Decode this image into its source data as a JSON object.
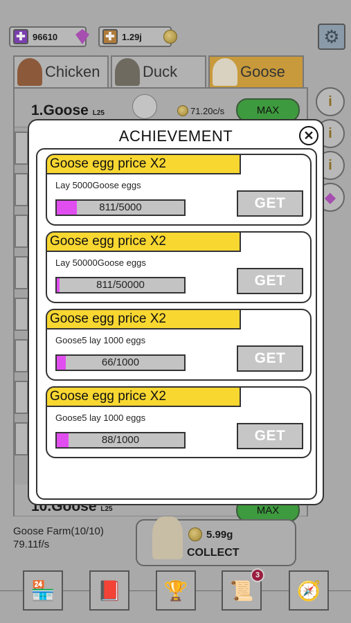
{
  "resources": {
    "gems": "96610",
    "gold": "1.29j"
  },
  "tabs": [
    {
      "label": "Chicken"
    },
    {
      "label": "Duck"
    },
    {
      "label": "Goose"
    }
  ],
  "list": {
    "first_row": {
      "name": "1.Goose",
      "level": "L25",
      "rate": "71.20c/s",
      "button": "MAX"
    },
    "last_row": {
      "name": "10.Goose",
      "level": "L25",
      "button": "MAX"
    }
  },
  "side_buttons": [
    "i",
    "i",
    "i"
  ],
  "farm": {
    "name": "Goose Farm(10/10)",
    "rate": "79.11f/s"
  },
  "collect": {
    "amount": "5.99g",
    "label": "COLLECT"
  },
  "nav": {
    "badge_count": "3"
  },
  "modal": {
    "title": "ACHIEVEMENT",
    "close": "✕",
    "achievements": [
      {
        "title": "Goose egg price X2",
        "desc": "Lay 5000Goose eggs",
        "progress_text": "811/5000",
        "progress": 0.16,
        "button": "GET"
      },
      {
        "title": "Goose egg price X2",
        "desc": "Lay 50000Goose eggs",
        "progress_text": "811/50000",
        "progress": 0.02,
        "button": "GET"
      },
      {
        "title": "Goose egg price X2",
        "desc": "Goose5 lay 1000 eggs",
        "progress_text": "66/1000",
        "progress": 0.07,
        "button": "GET"
      },
      {
        "title": "Goose egg price X2",
        "desc": "Goose5 lay 1000 eggs",
        "progress_text": "88/1000",
        "progress": 0.09,
        "button": "GET"
      }
    ]
  },
  "colors": {
    "achievement_header": "#f8d731",
    "progress_fill": "#e14ef0",
    "max_button": "#3e9a3e",
    "selected_tab": "#c89a3c"
  }
}
